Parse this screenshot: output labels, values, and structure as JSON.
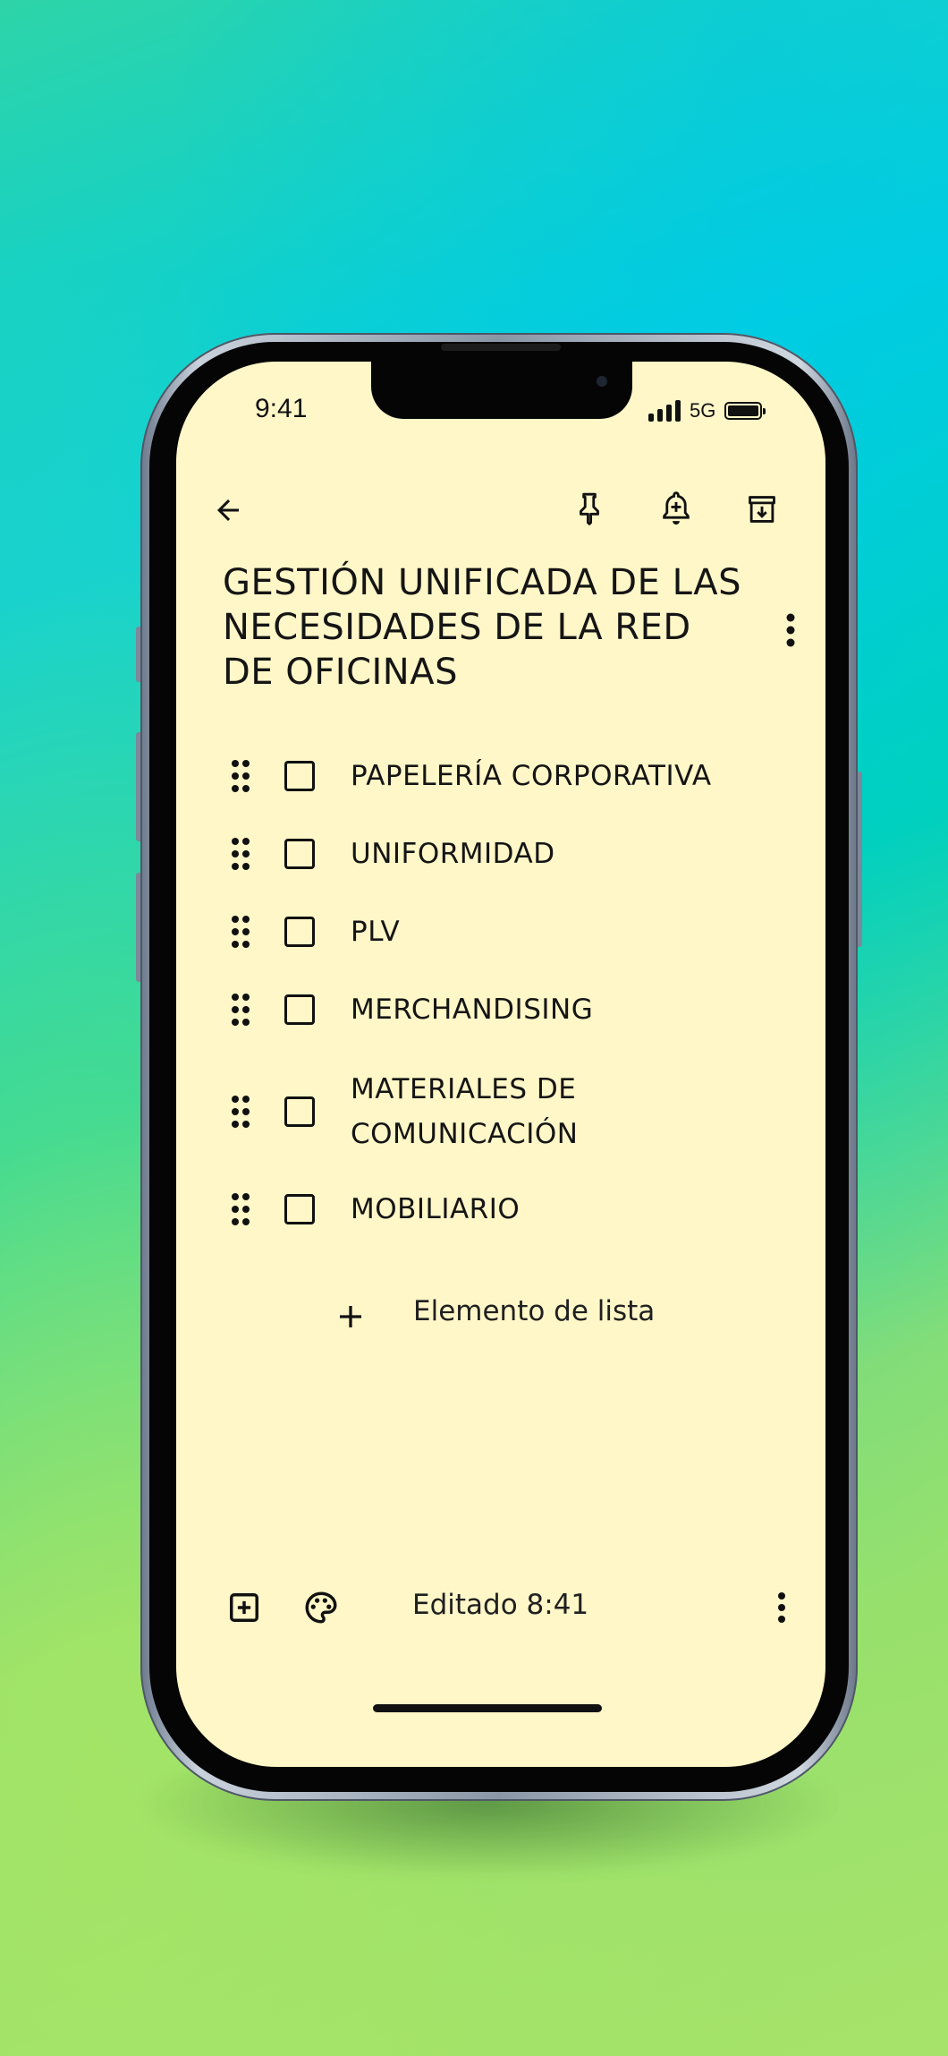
{
  "status_bar": {
    "time": "9:41",
    "network": "5G",
    "battery_level": 1.0
  },
  "toolbar": {
    "back_icon": "arrow-left-icon",
    "pin_icon": "pin-icon",
    "reminder_icon": "bell-plus-icon",
    "archive_icon": "archive-icon"
  },
  "note": {
    "title": "GESTIÓN UNIFICADA DE LAS NECESIDADES DE LA RED DE OFICINAS",
    "menu_icon": "more-vertical-icon",
    "items": [
      {
        "label": "PAPELERÍA CORPORATIVA",
        "checked": false
      },
      {
        "label": "UNIFORMIDAD",
        "checked": false
      },
      {
        "label": "PLV",
        "checked": false
      },
      {
        "label": "MERCHANDISING",
        "checked": false
      },
      {
        "label": "MATERIALES DE COMUNICACIÓN",
        "checked": false
      },
      {
        "label": "MOBILIARIO",
        "checked": false
      }
    ],
    "add_item_label": "Elemento de lista"
  },
  "bottom_bar": {
    "add_box_icon": "add-box-icon",
    "palette_icon": "palette-icon",
    "edited_label": "Editado 8:41",
    "more_icon": "more-vertical-icon"
  },
  "colors": {
    "note_background": "#fff7c8",
    "text": "#151515",
    "background_start": "#00cfe0",
    "background_end": "#a7e36a"
  }
}
